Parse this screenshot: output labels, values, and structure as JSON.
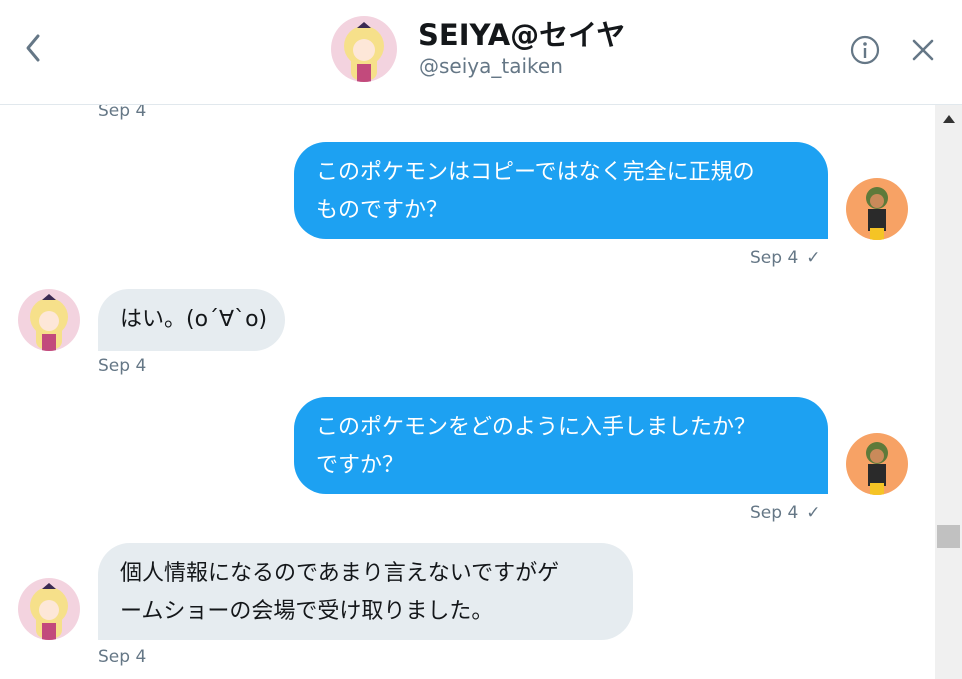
{
  "header": {
    "name": "SEIYA@セイヤ",
    "handle": "@seiya_taiken"
  },
  "messages": [
    {
      "from": "them",
      "time": "Sep 4"
    },
    {
      "from": "me",
      "text": "このポケモンはコピーではなく完全に正規の\nものですか？",
      "time": "Sep 4"
    },
    {
      "from": "them",
      "text": "はい。(o´∀`o)",
      "time": "Sep 4"
    },
    {
      "from": "me",
      "text": "このポケモンをどのように入手しましたか？\nですか？",
      "time": "Sep 4"
    },
    {
      "from": "them",
      "text": "個人情報になるのであまり言えないですがゲ\nームショーの会場で受け取りました。",
      "time": "Sep 4"
    }
  ],
  "icons": {
    "back": "chevron-left-icon",
    "info": "info-icon",
    "close": "close-icon",
    "read": "checkmark-icon"
  },
  "colors": {
    "sent_bubble": "#1da1f2",
    "received_bubble": "#e6ecf0",
    "secondary_text": "#657786"
  }
}
